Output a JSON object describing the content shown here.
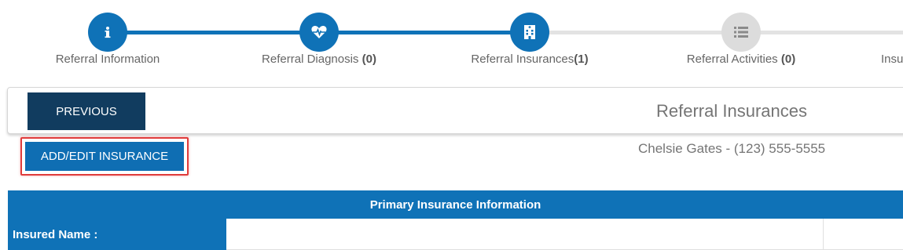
{
  "wizard": {
    "steps": [
      {
        "label": "Referral Information",
        "count": "",
        "icon": "info-icon",
        "state": "complete"
      },
      {
        "label": "Referral Diagnosis ",
        "count": "(0)",
        "icon": "heartbeat-icon",
        "state": "complete"
      },
      {
        "label": "Referral Insurances",
        "count": "(1)",
        "icon": "hospital-icon",
        "state": "current"
      },
      {
        "label": "Referral Activities ",
        "count": "(0)",
        "icon": "list-icon",
        "state": "incomplete"
      },
      {
        "label": "Insu",
        "count": "",
        "icon": "",
        "state": "incomplete"
      }
    ]
  },
  "toolbar": {
    "previous_label": "PREVIOUS",
    "title": "Referral Insurances"
  },
  "actions": {
    "add_edit_label": "ADD/EDIT INSURANCE"
  },
  "patient": {
    "summary": "Chelsie Gates - (123) 555-5555"
  },
  "insurance": {
    "header": "Primary Insurance Information",
    "rows": [
      {
        "label": "Insured Name :",
        "value": ""
      }
    ]
  },
  "colors": {
    "primary": "#0f72b7",
    "dark_button": "#113c5f",
    "highlight_border": "#e03c3c",
    "inactive_step": "#dcdcdc"
  }
}
